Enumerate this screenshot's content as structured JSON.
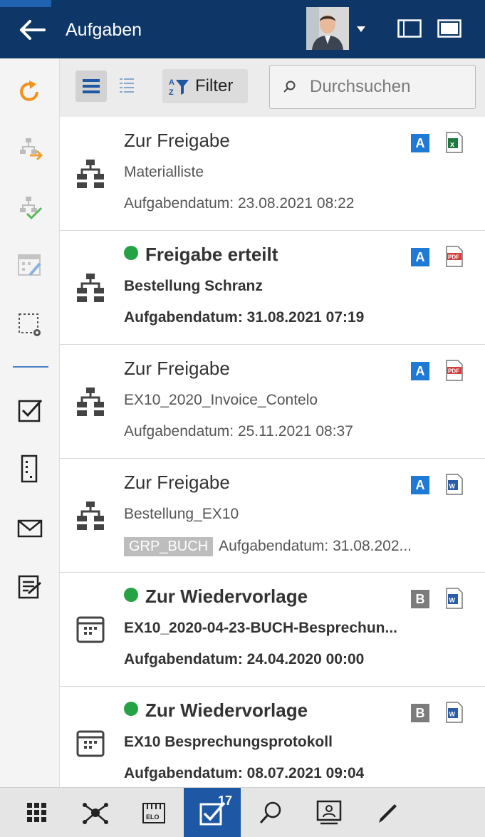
{
  "header": {
    "title": "Aufgaben",
    "back_icon": "arrow-left-icon",
    "avatar_icon": "user-avatar",
    "window_icons": [
      "single-pane-icon",
      "maximize-icon"
    ]
  },
  "toolbar": {
    "filter_label": "Filter",
    "search_placeholder": "Durchsuchen"
  },
  "rail": {
    "icons": [
      "refresh-icon",
      "forward-workflow-icon",
      "accept-workflow-icon",
      "calendar-edit-icon",
      "select-settings-icon",
      "tasks-icon",
      "form-icon",
      "mail-icon",
      "checklist-icon"
    ]
  },
  "tasks": [
    {
      "title": "Zur Freigabe",
      "subtitle": "Materialliste",
      "date": "Aufgabendatum: 23.08.2021 08:22",
      "priority": "A",
      "filetype": "excel",
      "unread": false,
      "icon": "workflow"
    },
    {
      "title": "Freigabe erteilt",
      "subtitle": "Bestellung Schranz",
      "date": "Aufgabendatum: 31.08.2021 07:19",
      "priority": "A",
      "filetype": "pdf",
      "unread": true,
      "icon": "workflow"
    },
    {
      "title": "Zur Freigabe",
      "subtitle": "EX10_2020_Invoice_Contelo",
      "date": "Aufgabendatum: 25.11.2021 08:37",
      "priority": "A",
      "filetype": "pdf",
      "unread": false,
      "icon": "workflow"
    },
    {
      "title": "Zur Freigabe",
      "subtitle": "Bestellung_EX10",
      "tag": "GRP_BUCH",
      "date": "Aufgabendatum: 31.08.202...",
      "priority": "A",
      "filetype": "word",
      "unread": false,
      "icon": "workflow"
    },
    {
      "title": "Zur Wiedervorlage",
      "subtitle": "EX10_2020-04-23-BUCH-Besprechun...",
      "date": "Aufgabendatum: 24.04.2020 00:00",
      "priority": "B",
      "filetype": "word",
      "unread": true,
      "icon": "calendar"
    },
    {
      "title": "Zur Wiedervorlage",
      "subtitle": "EX10 Besprechungsprotokoll",
      "date": "Aufgabendatum: 08.07.2021 09:04",
      "priority": "B",
      "filetype": "word",
      "unread": true,
      "icon": "calendar"
    }
  ],
  "bottombar": {
    "items": [
      "apps-grid-icon",
      "network-icon",
      "elo-archive-icon",
      "tasks-icon",
      "search-icon",
      "contacts-icon",
      "pen-icon"
    ],
    "tasks_count": "17",
    "active": "tasks-icon"
  },
  "colors": {
    "header": "#0e3768",
    "accent_blue": "#1f7ad6",
    "priority_b": "#7c7c7c",
    "green_dot": "#25a243",
    "refresh_orange": "#f0921e"
  }
}
